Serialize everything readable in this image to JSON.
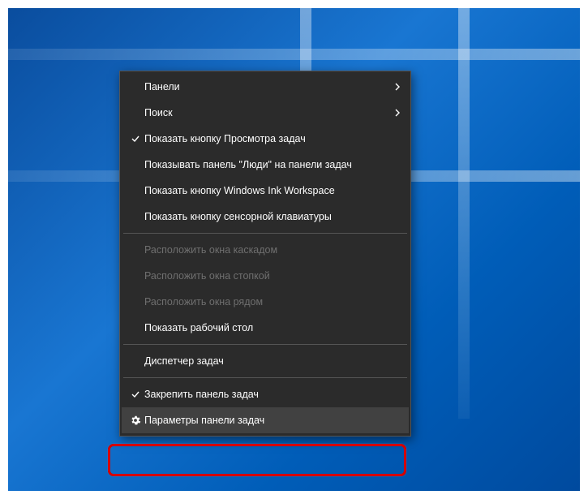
{
  "menu": {
    "groups": [
      [
        {
          "id": "panels",
          "label": "Панели",
          "submenu": true
        },
        {
          "id": "search",
          "label": "Поиск",
          "submenu": true
        },
        {
          "id": "taskview",
          "label": "Показать кнопку Просмотра задач",
          "checked": true
        },
        {
          "id": "people",
          "label": "Показывать панель \"Люди\" на панели задач"
        },
        {
          "id": "ink",
          "label": "Показать кнопку Windows Ink Workspace"
        },
        {
          "id": "touchkb",
          "label": "Показать кнопку сенсорной клавиатуры"
        }
      ],
      [
        {
          "id": "cascade",
          "label": "Расположить окна каскадом",
          "disabled": true
        },
        {
          "id": "stacked",
          "label": "Расположить окна стопкой",
          "disabled": true
        },
        {
          "id": "sidebyside",
          "label": "Расположить окна рядом",
          "disabled": true
        },
        {
          "id": "showdesk",
          "label": "Показать рабочий стол"
        }
      ],
      [
        {
          "id": "taskmgr",
          "label": "Диспетчер задач"
        }
      ],
      [
        {
          "id": "lock",
          "label": "Закрепить панель задач",
          "checked": true
        },
        {
          "id": "settings",
          "label": "Параметры панели задач",
          "icon": "gear",
          "highlighted": true
        }
      ]
    ]
  },
  "colors": {
    "menuBg": "#2b2b2b",
    "menuText": "#ffffff",
    "menuDisabled": "#6f6f6f",
    "highlight": "#414141",
    "emphasisBorder": "#d40000"
  }
}
